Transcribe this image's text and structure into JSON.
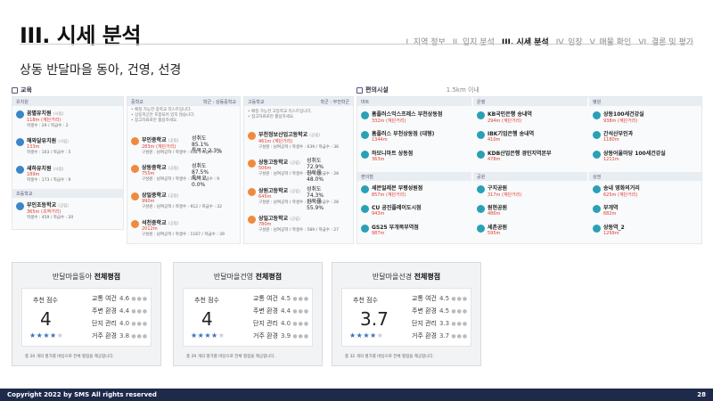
{
  "header": {
    "title": "III. 시세 분석",
    "nav": [
      "I. 지역 정보",
      "II. 입지 분석",
      "III. 시세 분석",
      "IV. 임장",
      "V. 매물 확인",
      "VI. 결론 및 평가"
    ],
    "active_index": 2
  },
  "subtitle": "상동 반달마을 동아, 건영, 선경",
  "education": {
    "heading": "교육",
    "col_kinder": "유치원",
    "col_kinder_sub": "초등학교",
    "col_middle": "중학교",
    "col_middle_right": "학군 : 상동중학교",
    "col_high": "고등학교",
    "col_high_right": "학군 : 부천학군",
    "kinder": [
      {
        "name": "꿈별유치원",
        "tag": "(사립)",
        "dist": "118m (계단거리)",
        "stat": "학생수 : 29 / 학급수 : 2"
      },
      {
        "name": "해와달유치원",
        "tag": "(사립)",
        "dist": "133m",
        "stat": "학생수 : 103 / 학급수 : 5"
      },
      {
        "name": "새하유치원",
        "tag": "(사립)",
        "dist": "189m",
        "stat": "학생수 : 173 / 학급수 : 9"
      }
    ],
    "elementary": [
      {
        "name": "부인초등학교",
        "tag": "(공립)",
        "dist": "365m (초역거리)",
        "stat": "학생수 : 459 / 학급수 : 20"
      }
    ],
    "middle_notes": [
      "• 배정 가능한 중학교 리스트입니다.",
      "• 상동학군안 포함되어 있지 않습니다.",
      "• 참고자료로만 활용하세요."
    ],
    "middle": [
      {
        "name": "부인중학교",
        "tag": "(공립)",
        "dist": "283m (계단거리)",
        "stat": "구성원 : 남여공학 / 학생수 : 621 / 학급수 : 23",
        "rate1": "성취도 85.1%",
        "rate2": "특목고 2.3%"
      },
      {
        "name": "상동중학교",
        "tag": "(공립)",
        "dist": "755m",
        "stat": "구성원 : 남여공학 / 학생수 : 182 / 학급수 : 9",
        "rate1": "성취도 87.5%",
        "rate2": "특목고 0.0%"
      },
      {
        "name": "상일중학교",
        "tag": "(공립)",
        "dist": "990m",
        "stat": "구성원 : 남여공학 / 학생수 : 912 / 학급수 : 32",
        "rate1": "",
        "rate2": ""
      },
      {
        "name": "석천중학교",
        "tag": "(공립)",
        "dist": "2012m",
        "stat": "구성원 : 남여공학 / 학생수 : 1167 / 학급수 : 39",
        "rate1": "",
        "rate2": ""
      }
    ],
    "high_notes": [
      "• 배정 가능한 고등학교 리스트입니다.",
      "• 참고자료로만 활용하세요."
    ],
    "high": [
      {
        "name": "부천정보산업고등학교",
        "tag": "(공립)",
        "dist": "461m (계단거리)",
        "stat": "구성원 : 남여공학 / 학생수 : 639 / 학급수 : 36",
        "rate1": "",
        "rate2": ""
      },
      {
        "name": "상동고등학교",
        "tag": "(공립)",
        "dist": "506m",
        "stat": "구성원 : 남여공학 / 학생수 : 699 / 학급수 : 28",
        "rate1": "성취도 72.9%",
        "rate2": "진학률 48.0%"
      },
      {
        "name": "상원고등학교",
        "tag": "(공립)",
        "dist": "645m",
        "stat": "구성원 : 남여공학 / 학생수 : 697 / 학급수 : 28",
        "rate1": "성취도 74.3%",
        "rate2": "진학률 55.9%"
      },
      {
        "name": "상일고등학교",
        "tag": "(공립)",
        "dist": "780m",
        "stat": "구성원 : 남여공학 / 학생수 : 589 / 학급수 : 27",
        "rate1": "",
        "rate2": ""
      }
    ]
  },
  "amenities": {
    "heading": "편의시설",
    "range": "1.5km 이내",
    "col_mart": "마트",
    "col_bank": "은행",
    "col_hospital": "병원",
    "col_convenience": "편의점",
    "col_park": "공원",
    "col_mall": "상권",
    "mart": [
      {
        "name": "홈플러스익스프레스 부천상동점",
        "dist": "332m (계단거리)"
      },
      {
        "name": "홈플러스 부천상동점 (대형)",
        "dist": "1344m"
      },
      {
        "name": "하모니마트 상동점",
        "dist": "363m"
      }
    ],
    "convenience": [
      {
        "name": "세븐일레븐 부평성원점",
        "dist": "857m (계단거리)"
      },
      {
        "name": "CU 공진플레이도시점",
        "dist": "943m"
      },
      {
        "name": "GS25 부개복부역점",
        "dist": "987m"
      }
    ],
    "bank": [
      {
        "name": "KB국민은행 송내역",
        "dist": "294m (계단거리)"
      },
      {
        "name": "IBK기업은행 송내역",
        "dist": "410m"
      },
      {
        "name": "KDB산업은행 경인지역본부",
        "dist": "478m"
      }
    ],
    "park": [
      {
        "name": "구지공원",
        "dist": "317m (계단거리)"
      },
      {
        "name": "원현공원",
        "dist": "486m"
      },
      {
        "name": "세촌공원",
        "dist": "595m"
      }
    ],
    "hospital": [
      {
        "name": "상동100세건강실",
        "dist": "938m (계단거리)"
      },
      {
        "name": "간석산부인과",
        "dist": "1180m"
      },
      {
        "name": "상동어울마당 100세건강실",
        "dist": "1211m"
      }
    ],
    "mall": [
      {
        "name": "송내 영화의거리",
        "dist": "625m (계단거리)"
      },
      {
        "name": "부개역",
        "dist": "682m"
      },
      {
        "name": "상동역_2",
        "dist": "1299m"
      }
    ]
  },
  "cards": [
    {
      "title_prefix": "반달마을동아",
      "title_bold": "전체평점",
      "score_label": "추천 점수",
      "score": "4",
      "rating": 4,
      "metrics": [
        {
          "label": "교통 여건",
          "value": "4.6"
        },
        {
          "label": "주변 환경",
          "value": "4.4"
        },
        {
          "label": "단지 관리",
          "value": "4.0"
        },
        {
          "label": "거주 환경",
          "value": "3.8"
        }
      ],
      "footer": "총 20 개의 평가를 바탕으로 전체 평점을 제공합니다."
    },
    {
      "title_prefix": "반달마을건영",
      "title_bold": "전체평점",
      "score_label": "추천 점수",
      "score": "4",
      "rating": 4,
      "metrics": [
        {
          "label": "교통 여건",
          "value": "4.5"
        },
        {
          "label": "주변 환경",
          "value": "4.4"
        },
        {
          "label": "단지 관리",
          "value": "4.0"
        },
        {
          "label": "거주 환경",
          "value": "3.9"
        }
      ],
      "footer": "총 29 개의 평가를 바탕으로 전체 평점을 제공합니다."
    },
    {
      "title_prefix": "반달마을선경",
      "title_bold": "전체평점",
      "score_label": "추천 점수",
      "score": "3.7",
      "rating": 4,
      "metrics": [
        {
          "label": "교통 여건",
          "value": "4.5"
        },
        {
          "label": "주변 환경",
          "value": "4.5"
        },
        {
          "label": "단지 관리",
          "value": "3.3"
        },
        {
          "label": "거주 환경",
          "value": "3.7"
        }
      ],
      "footer": "총 32 개의 평가를 바탕으로 전체 평점을 제공합니다."
    }
  ],
  "footer": {
    "copyright": "Copyright 2022 by SMS All rights reserved",
    "page": "28"
  },
  "colors": {
    "accent": "#3a6fc0",
    "distance": "#e03c31",
    "footer_bg": "#1e2a4a"
  }
}
